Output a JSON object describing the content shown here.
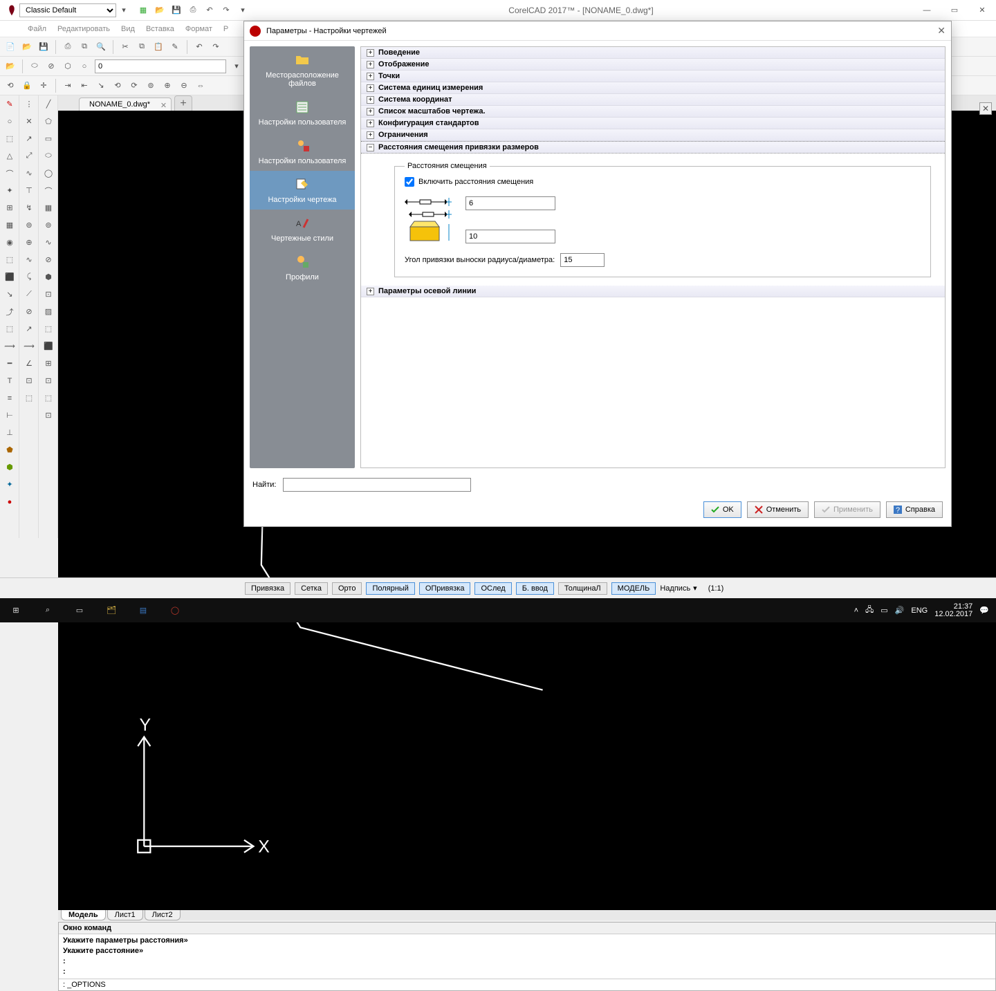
{
  "app": {
    "title": "CorelCAD 2017™ - [NONAME_0.dwg*]",
    "workspace": "Classic Default",
    "doc_tab": "NONAME_0.dwg*"
  },
  "menu": [
    "Файл",
    "Редактировать",
    "Вид",
    "Вставка",
    "Формат",
    "Р"
  ],
  "coord_input": "0",
  "sheet_tabs": {
    "model": "Модель",
    "s1": "Лист1",
    "s2": "Лист2"
  },
  "cmd": {
    "header": "Окно команд",
    "l1": "Укажите параметры расстояния»",
    "l2": "Укажите расстояние»",
    "prompt": ": _OPTIONS"
  },
  "status": {
    "btns": [
      "Привязка",
      "Сетка",
      "Орто"
    ],
    "blue": [
      "Полярный",
      "ОПривязка",
      "ОСлед",
      "Б. ввод"
    ],
    "plain": [
      "ТолщинаЛ"
    ],
    "model": "МОДЕЛЬ",
    "combo": "Надпись",
    "ratio": "(1:1)"
  },
  "taskbar": {
    "lang": "ENG",
    "time": "21:37",
    "date": "12.02.2017"
  },
  "dialog": {
    "title": "Параметры - Настройки чертежей",
    "categories": [
      "Месторасположение файлов",
      "Настройки пользователя",
      "Настройки пользователя",
      "Настройки чертежа",
      "Чертежные стили",
      "Профили"
    ],
    "active_cat": 3,
    "tree": [
      {
        "label": "Поведение",
        "open": false
      },
      {
        "label": "Отображение",
        "open": false
      },
      {
        "label": "Точки",
        "open": false
      },
      {
        "label": "Система единиц измерения",
        "open": false
      },
      {
        "label": "Система координат",
        "open": false
      },
      {
        "label": "Список масштабов чертежа.",
        "open": false
      },
      {
        "label": "Конфигурация стандартов",
        "open": false
      },
      {
        "label": "Ограничения",
        "open": false
      },
      {
        "label": "Расстояния смещения привязки размеров",
        "open": true
      },
      {
        "label": "Параметры осевой линии",
        "open": false
      }
    ],
    "panel": {
      "legend": "Расстояния смещения",
      "checkbox": "Включить расстояния смещения",
      "val1": "6",
      "val2": "10",
      "angle_label": "Угол привязки выноски радиуса/диаметра:",
      "angle_val": "15"
    },
    "find_label": "Найти:",
    "buttons": {
      "ok": "OK",
      "cancel": "Отменить",
      "apply": "Применить",
      "help": "Справка"
    }
  }
}
